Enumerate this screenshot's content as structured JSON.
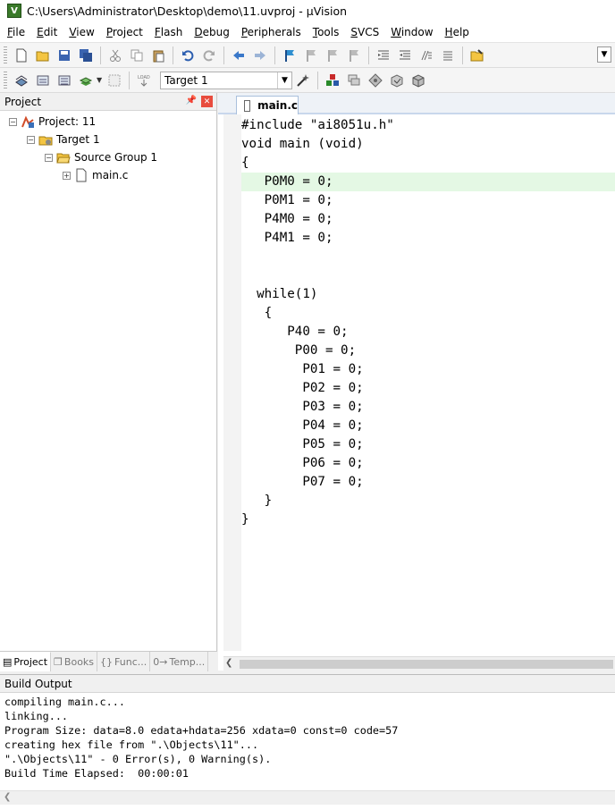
{
  "window": {
    "title": "C:\\Users\\Administrator\\Desktop\\demo\\11.uvproj - µVision",
    "app_icon": "µVision-icon"
  },
  "menu": [
    "File",
    "Edit",
    "View",
    "Project",
    "Flash",
    "Debug",
    "Peripherals",
    "Tools",
    "SVCS",
    "Window",
    "Help"
  ],
  "toolbar": {
    "target_value": "Target 1"
  },
  "project_pane": {
    "title": "Project",
    "tree": [
      {
        "label": "Project: 11",
        "expander": "−"
      },
      {
        "label": "Target 1",
        "expander": "−"
      },
      {
        "label": "Source Group 1",
        "expander": "−"
      },
      {
        "label": "main.c",
        "expander": "+"
      }
    ],
    "tabs": [
      {
        "label": "Project",
        "icon": "▤"
      },
      {
        "label": "Books",
        "icon": "❒"
      },
      {
        "label": "Func...",
        "icon": "{}"
      },
      {
        "label": "Temp...",
        "icon": "0→"
      }
    ]
  },
  "editor": {
    "tab_label": "main.c",
    "highlight_line": 4,
    "lines": [
      "#include \"ai8051u.h\"",
      "void main (void)",
      "{",
      "   P0M0 = 0;",
      "   P0M1 = 0;",
      "   P4M0 = 0;",
      "   P4M1 = 0;",
      "",
      "",
      "  while(1)",
      "   {",
      "      P40 = 0;",
      "       P00 = 0;",
      "        P01 = 0;",
      "        P02 = 0;",
      "        P03 = 0;",
      "        P04 = 0;",
      "        P05 = 0;",
      "        P06 = 0;",
      "        P07 = 0;",
      "   }",
      "}"
    ]
  },
  "build_output": {
    "title": "Build Output",
    "lines": [
      "compiling main.c...",
      "linking...",
      "Program Size: data=8.0 edata+hdata=256 xdata=0 const=0 code=57",
      "creating hex file from \".\\Objects\\11\"...",
      "\".\\Objects\\11\" - 0 Error(s), 0 Warning(s).",
      "Build Time Elapsed:  00:00:01"
    ]
  }
}
